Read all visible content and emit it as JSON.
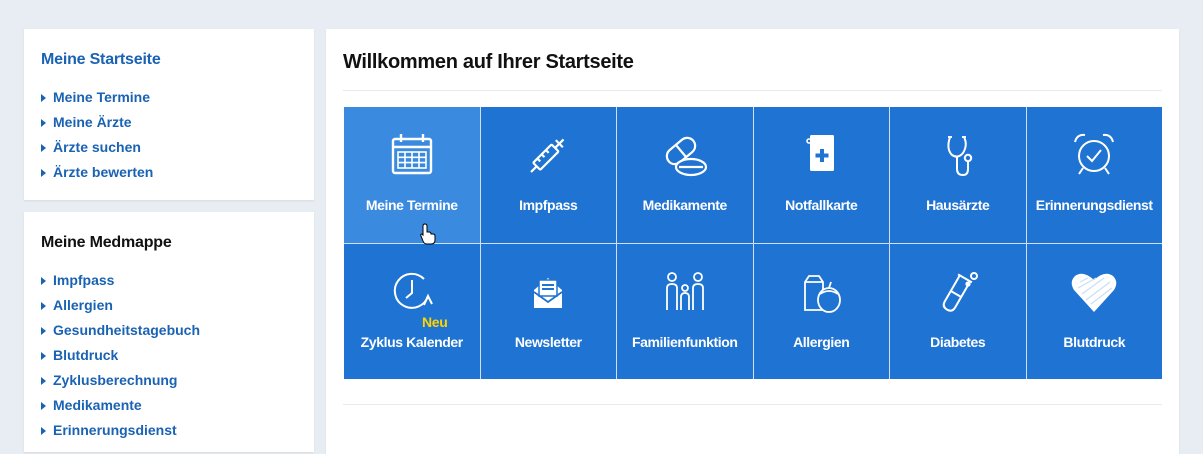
{
  "sidebar": {
    "start_box": {
      "title": "Meine Startseite",
      "items": [
        {
          "label": "Meine Termine"
        },
        {
          "label": "Meine Ärzte"
        },
        {
          "label": "Ärzte suchen"
        },
        {
          "label": "Ärzte bewerten"
        }
      ]
    },
    "medmappe_box": {
      "title": "Meine Medmappe",
      "items": [
        {
          "label": "Impfpass"
        },
        {
          "label": "Allergien"
        },
        {
          "label": "Gesundheitstagebuch"
        },
        {
          "label": "Blutdruck"
        },
        {
          "label": "Zyklusberechnung"
        },
        {
          "label": "Medikamente"
        },
        {
          "label": "Erinnerungsdienst"
        }
      ]
    }
  },
  "main": {
    "title": "Willkommen auf Ihrer Startseite",
    "tiles": [
      {
        "label": "Meine Termine",
        "icon": "calendar-icon"
      },
      {
        "label": "Impfpass",
        "icon": "syringe-icon"
      },
      {
        "label": "Medikamente",
        "icon": "pills-icon"
      },
      {
        "label": "Notfallkarte",
        "icon": "emergency-card-icon"
      },
      {
        "label": "Hausärzte",
        "icon": "stethoscope-icon"
      },
      {
        "label": "Erinnerungsdienst",
        "icon": "alarm-clock-icon"
      },
      {
        "label": "Zyklus Kalender",
        "icon": "cycle-clock-icon",
        "badge": "Neu"
      },
      {
        "label": "Newsletter",
        "icon": "newsletter-icon"
      },
      {
        "label": "Familienfunktion",
        "icon": "family-icon"
      },
      {
        "label": "Allergien",
        "icon": "allergy-icon"
      },
      {
        "label": "Diabetes",
        "icon": "test-tube-icon"
      },
      {
        "label": "Blutdruck",
        "icon": "heart-icon"
      }
    ]
  },
  "colors": {
    "background": "#e8edf3",
    "tile": "#1f73d2",
    "tile_hover": "#3a8ae0",
    "link": "#1a62b3",
    "badge": "#ffd400"
  }
}
